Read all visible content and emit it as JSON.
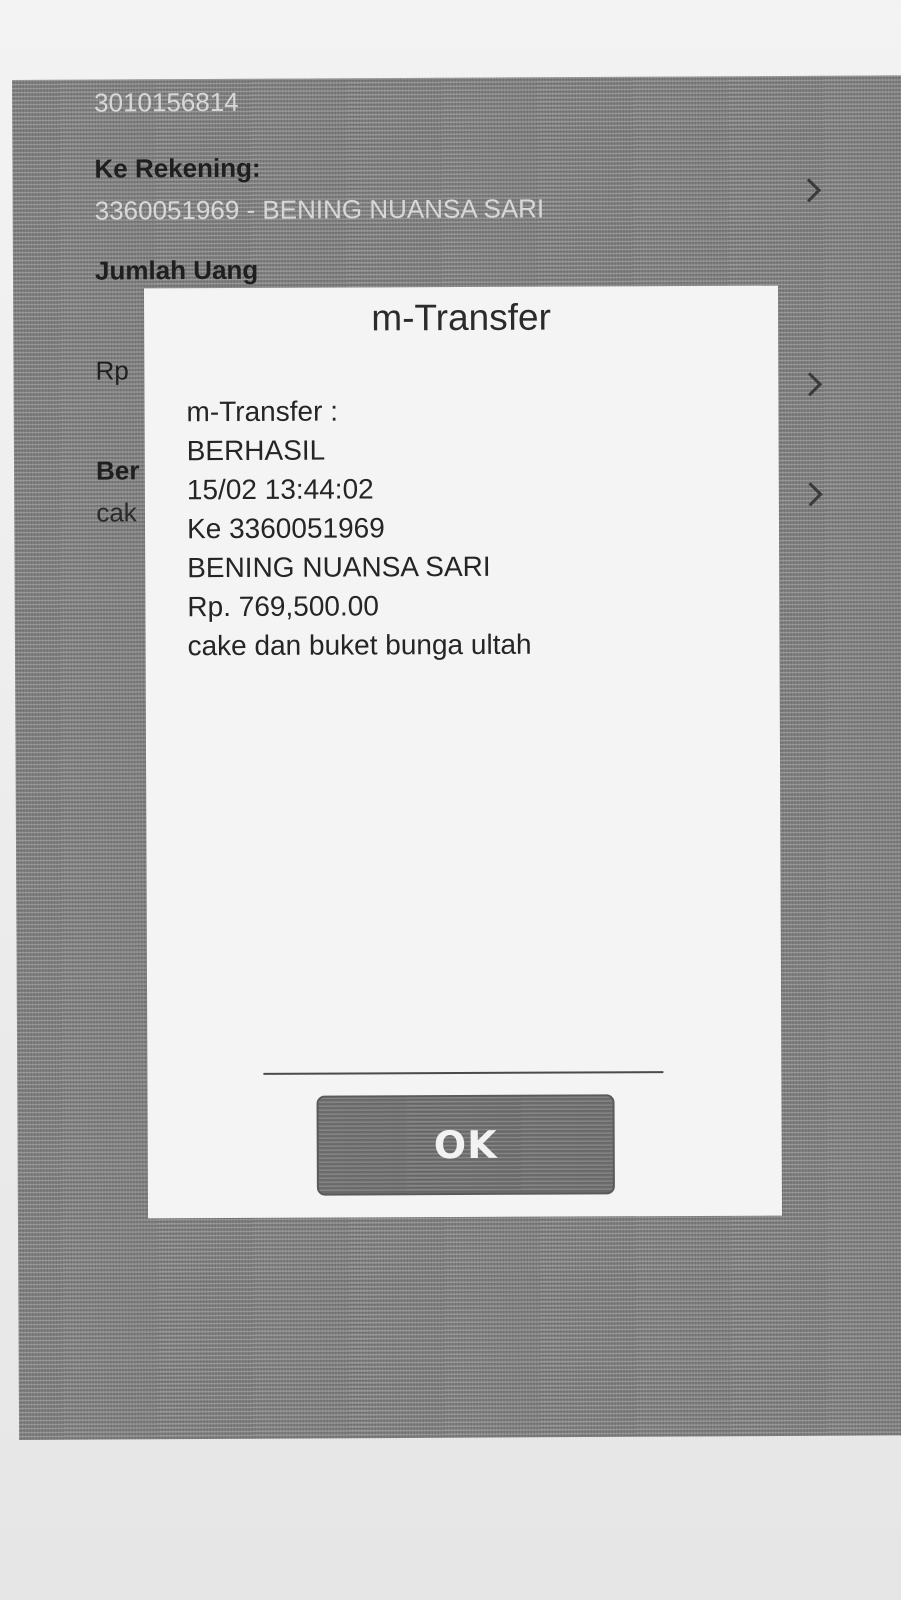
{
  "background_form": {
    "from_account": "3010156814",
    "to_account_label": "Ke Rekening:",
    "to_account_value": "3360051969 - BENING NUANSA SARI",
    "amount_label": "Jumlah Uang",
    "amount_prefix": "Rp",
    "description_label_partial": "Ber",
    "description_value_partial": "cak"
  },
  "dialog": {
    "title": "m-Transfer",
    "lines": [
      "m-Transfer :",
      "BERHASIL",
      "15/02 13:44:02",
      "Ke 3360051969",
      "BENING NUANSA SARI",
      "Rp. 769,500.00",
      "cake dan buket bunga ultah"
    ],
    "ok_label": "OK"
  },
  "icons": {
    "row_chevron": "chevron-right-icon"
  }
}
